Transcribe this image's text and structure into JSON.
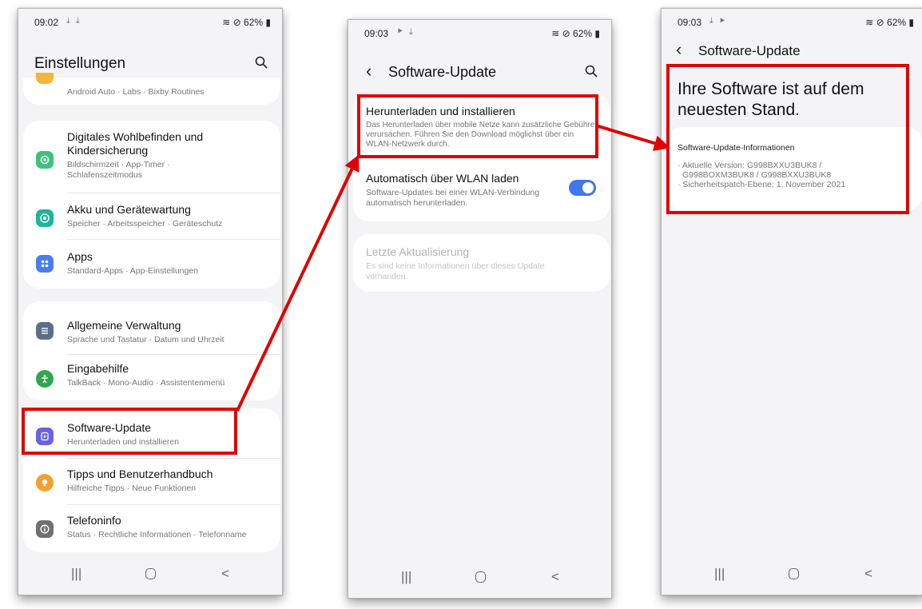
{
  "screen1": {
    "status": {
      "time": "09:02",
      "notif": "⤓ ⤓",
      "right": "62%"
    },
    "title": "Einstellungen",
    "partial_item": {
      "subtitle": "Android Auto  ·  Labs  ·  Bixby Routines"
    },
    "items": [
      {
        "title": "Digitales Wohlbefinden und Kindersicherung",
        "subtitle": "Bildschirmzeit  ·  App-Timer  ·  Schlafenszeitmodus",
        "icon": "wellbeing-icon",
        "color": "#3ec17d"
      },
      {
        "title": "Akku und Gerätewartung",
        "subtitle": "Speicher  ·  Arbeitsspeicher  ·  Geräteschutz",
        "icon": "device-care-icon",
        "color": "#1fb59a"
      },
      {
        "title": "Apps",
        "subtitle": "Standard-Apps  ·  App-Einstellungen",
        "icon": "apps-icon",
        "color": "#4a7cf0"
      },
      {
        "title": "Allgemeine Verwaltung",
        "subtitle": "Sprache und Tastatur  ·  Datum und Uhrzeit",
        "icon": "general-management-icon",
        "color": "#5b6f8a"
      },
      {
        "title": "Eingabehilfe",
        "subtitle": "TalkBack  ·  Mono-Audio  ·  Assistentenmenü",
        "icon": "accessibility-icon",
        "color": "#2fa64d"
      },
      {
        "title": "Software-Update",
        "subtitle": "Herunterladen und installieren",
        "icon": "software-update-icon",
        "color": "#6a63e0"
      },
      {
        "title": "Tipps und Benutzerhandbuch",
        "subtitle": "Hilfreiche Tipps  ·  Neue Funktionen",
        "icon": "tips-icon",
        "color": "#f2a02f"
      },
      {
        "title": "Telefoninfo",
        "subtitle": "Status  ·  Rechtliche Informationen  ·  Telefonname",
        "icon": "phone-info-icon",
        "color": "#707070"
      }
    ]
  },
  "screen2": {
    "status": {
      "time": "09:03",
      "notif": "⯈ ⤓",
      "right": "62%"
    },
    "title": "Software-Update",
    "download": {
      "title": "Herunterladen und installieren",
      "subtitle": "Das Herunterladen über mobile Netze kann zusätzliche Gebühren verursachen. Führen Sie den Download möglichst über ein WLAN-Netzwerk durch."
    },
    "auto_wifi": {
      "title": "Automatisch über WLAN laden",
      "subtitle": "Software-Updates bei einer WLAN-Verbindung automatisch herunterladen.",
      "toggle_on": true
    },
    "last_update": {
      "title": "Letzte Aktualisierung",
      "subtitle": "Es sind keine Informationen über dieses Update vorhanden."
    }
  },
  "screen3": {
    "status": {
      "time": "09:03",
      "notif": "⤓ ⯈",
      "right": "62%"
    },
    "title": "Software-Update",
    "headline": "Ihre Software ist auf dem neuesten Stand.",
    "info_title": "Software-Update-Informationen",
    "info_line1": "· Aktuelle Version: G998BXXU3BUK8 /",
    "info_line2": "G998BOXM3BUK8 / G998BXXU3BUK8",
    "info_line3": "· Sicherheitspatch-Ebene: 1. November 2021"
  },
  "nav": {
    "recents": "|||",
    "home": "",
    "back": "<"
  },
  "colors": {
    "accent_red": "#e00000",
    "toggle_blue": "#3e78ec",
    "background": "#f4f4f6"
  }
}
